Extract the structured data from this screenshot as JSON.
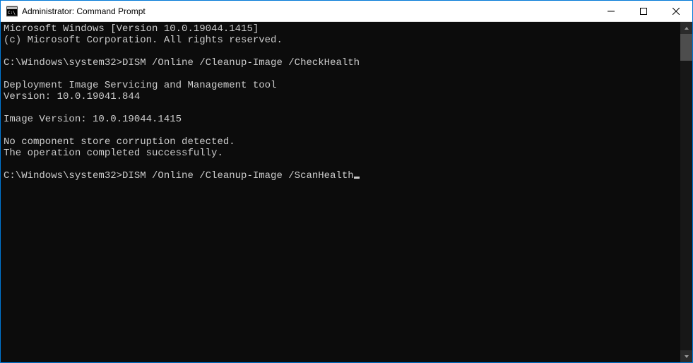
{
  "titlebar": {
    "title": "Administrator: Command Prompt"
  },
  "terminal": {
    "lines": [
      "Microsoft Windows [Version 10.0.19044.1415]",
      "(c) Microsoft Corporation. All rights reserved.",
      "",
      "C:\\Windows\\system32>DISM /Online /Cleanup-Image /CheckHealth",
      "",
      "Deployment Image Servicing and Management tool",
      "Version: 10.0.19041.844",
      "",
      "Image Version: 10.0.19044.1415",
      "",
      "No component store corruption detected.",
      "The operation completed successfully.",
      "",
      "C:\\Windows\\system32>DISM /Online /Cleanup-Image /ScanHealth"
    ]
  }
}
